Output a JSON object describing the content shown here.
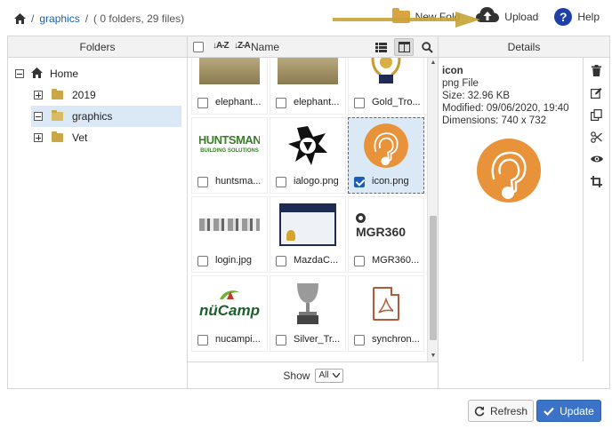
{
  "breadcrumb": {
    "separator": "/",
    "current_folder": "graphics",
    "info": "( 0 folders, 29 files)"
  },
  "toolbar": {
    "new_folder_label": "New Fold",
    "upload_label": "Upload",
    "help_label": "Help"
  },
  "folders_pane": {
    "header": "Folders",
    "tree": [
      {
        "label": "Home",
        "level": 0,
        "toggle": "minus",
        "icon": "home-icon",
        "selected": false
      },
      {
        "label": "2019",
        "level": 1,
        "toggle": "plus",
        "icon": "folder-icon",
        "selected": false
      },
      {
        "label": "graphics",
        "level": 1,
        "toggle": "minus",
        "icon": "folder-open-icon",
        "selected": true
      },
      {
        "label": "Vet",
        "level": 1,
        "toggle": "plus",
        "icon": "folder-icon",
        "selected": false
      }
    ]
  },
  "files_pane": {
    "sort_az": "A-Z",
    "sort_za": "Z-A",
    "name_header": "Name",
    "files": [
      {
        "name": "elephant...",
        "thumb": "elephants",
        "checked": false,
        "selected": false
      },
      {
        "name": "elephant...",
        "thumb": "elephants",
        "checked": false,
        "selected": false
      },
      {
        "name": "Gold_Tro...",
        "thumb": "gold-trophy",
        "checked": false,
        "selected": false
      },
      {
        "name": "huntsma...",
        "thumb": "huntsman",
        "checked": false,
        "selected": false
      },
      {
        "name": "ialogo.png",
        "thumb": "ialogo",
        "checked": false,
        "selected": false
      },
      {
        "name": "icon.png",
        "thumb": "icon",
        "checked": true,
        "selected": true
      },
      {
        "name": "login.jpg",
        "thumb": "login",
        "checked": false,
        "selected": false
      },
      {
        "name": "MazdaC...",
        "thumb": "certificate",
        "checked": false,
        "selected": false
      },
      {
        "name": "MGR360...",
        "thumb": "mgr360",
        "checked": false,
        "selected": false
      },
      {
        "name": "nucampi...",
        "thumb": "nucamp",
        "checked": false,
        "selected": false
      },
      {
        "name": "Silver_Tr...",
        "thumb": "silver-trophy",
        "checked": false,
        "selected": false
      },
      {
        "name": "synchron...",
        "thumb": "pdf",
        "checked": false,
        "selected": false
      }
    ],
    "thumb_text": {
      "huntsman_main": "HUNTSMAN",
      "huntsman_sub": "BUILDING SOLUTIONS",
      "mgr360": "MGR360",
      "nucamp": "nüCamp"
    },
    "show_label": "Show",
    "show_value": "All"
  },
  "details_pane": {
    "header": "Details",
    "name": "icon",
    "type": "png File",
    "size": "Size: 32.96 KB",
    "modified": "Modified: 09/06/2020, 19:40",
    "dimensions": "Dimensions: 740 x 732"
  },
  "footer": {
    "refresh_label": "Refresh",
    "update_label": "Update"
  },
  "colors": {
    "accent": "#3a73c8",
    "selection": "#dbe8f6",
    "icon_orange": "#e8923a",
    "annotation_arrow": "#c8a43a"
  }
}
